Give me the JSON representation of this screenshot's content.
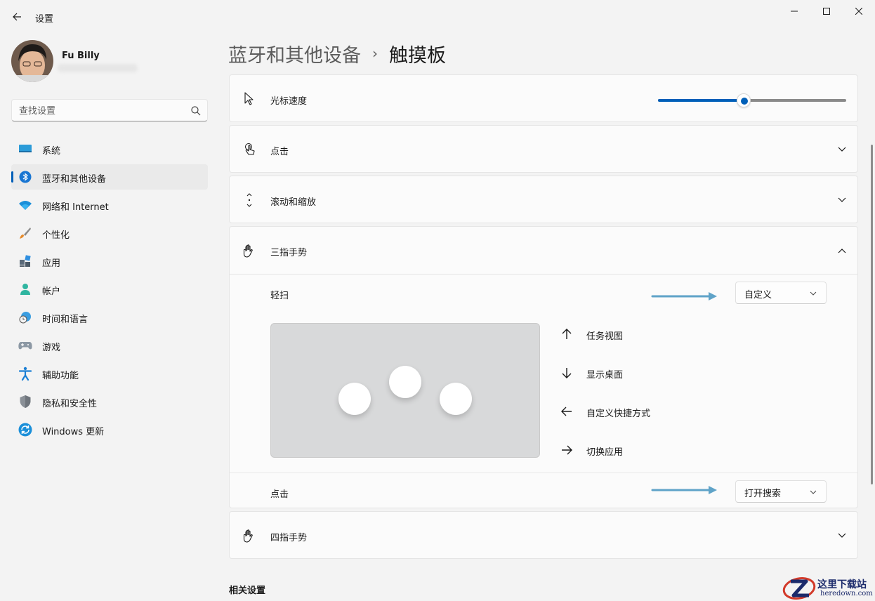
{
  "window": {
    "title": "设置",
    "buttons": [
      "minimize-icon",
      "maximize-icon",
      "close-icon"
    ]
  },
  "profile": {
    "name": "Fu Billy"
  },
  "search": {
    "placeholder": "查找设置"
  },
  "sidebar": {
    "items": [
      {
        "label": "系统",
        "icon": "monitor-icon"
      },
      {
        "label": "蓝牙和其他设备",
        "icon": "bluetooth-icon",
        "active": true
      },
      {
        "label": "网络和 Internet",
        "icon": "wifi-icon"
      },
      {
        "label": "个性化",
        "icon": "brush-icon"
      },
      {
        "label": "应用",
        "icon": "apps-icon"
      },
      {
        "label": "帐户",
        "icon": "account-icon"
      },
      {
        "label": "时间和语言",
        "icon": "clock-globe-icon"
      },
      {
        "label": "游戏",
        "icon": "gamepad-icon"
      },
      {
        "label": "辅助功能",
        "icon": "accessibility-icon"
      },
      {
        "label": "隐私和安全性",
        "icon": "shield-icon"
      },
      {
        "label": "Windows 更新",
        "icon": "update-icon"
      }
    ]
  },
  "breadcrumb": {
    "parent": "蓝牙和其他设备",
    "separator": "›",
    "current": "触摸板"
  },
  "settings": {
    "cursor_speed": {
      "label": "光标速度",
      "value_fraction": 0.45
    },
    "tap": {
      "label": "点击"
    },
    "scroll_zoom": {
      "label": "滚动和缩放"
    },
    "three_finger": {
      "label": "三指手势",
      "swipe_label": "轻扫",
      "swipe_value": "自定义",
      "gestures": [
        {
          "direction": "up",
          "label": "任务视图"
        },
        {
          "direction": "down",
          "label": "显示桌面"
        },
        {
          "direction": "left",
          "label": "自定义快捷方式"
        },
        {
          "direction": "right",
          "label": "切换应用"
        }
      ],
      "tap_label": "点击",
      "tap_value": "打开搜索"
    },
    "four_finger": {
      "label": "四指手势"
    }
  },
  "related": {
    "title": "相关设置"
  },
  "watermark": {
    "text": "这里下载站",
    "sub": "heredown.com"
  },
  "colors": {
    "accent": "#005fb8",
    "annotation_arrow": "#5fa3c8",
    "background": "#f3f3f3",
    "card": "#fbfbfb"
  }
}
